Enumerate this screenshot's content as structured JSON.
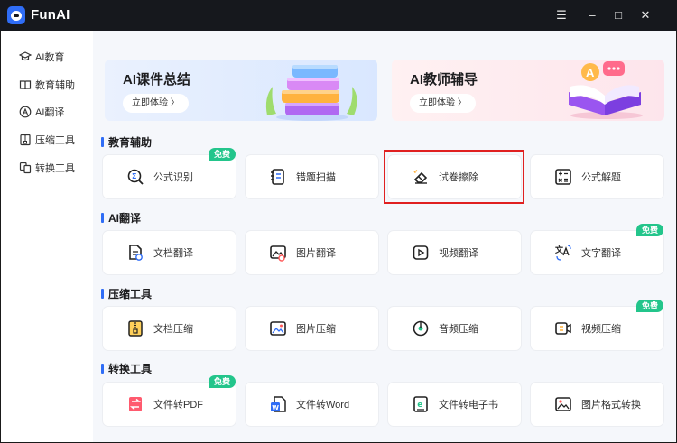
{
  "app": {
    "title": "FunAI"
  },
  "window_controls": [
    {
      "name": "menu-icon",
      "glyph": "☰"
    },
    {
      "name": "minimize-icon",
      "glyph": "–"
    },
    {
      "name": "maximize-icon",
      "glyph": "□"
    },
    {
      "name": "close-icon",
      "glyph": "✕"
    }
  ],
  "sidebar": {
    "items": [
      {
        "label": "AI教育",
        "icon": "graduation-cap-icon"
      },
      {
        "label": "教育辅助",
        "icon": "book-icon"
      },
      {
        "label": "AI翻译",
        "icon": "translate-icon"
      },
      {
        "label": "压缩工具",
        "icon": "compress-icon"
      },
      {
        "label": "转换工具",
        "icon": "convert-icon"
      }
    ]
  },
  "banners": [
    {
      "title": "AI课件总结",
      "button": "立即体验 〉"
    },
    {
      "title": "AI教师辅导",
      "button": "立即体验 〉"
    }
  ],
  "sections": [
    {
      "title": "教育辅助",
      "cards": [
        {
          "label": "公式识别",
          "icon": "formula-recognition-icon",
          "badge": "免费"
        },
        {
          "label": "错题扫描",
          "icon": "wrong-question-scan-icon",
          "badge": ""
        },
        {
          "label": "试卷擦除",
          "icon": "paper-eraser-icon",
          "badge": ""
        },
        {
          "label": "公式解题",
          "icon": "formula-solve-icon",
          "badge": ""
        }
      ]
    },
    {
      "title": "AI翻译",
      "cards": [
        {
          "label": "文档翻译",
          "icon": "document-translate-icon",
          "badge": ""
        },
        {
          "label": "图片翻译",
          "icon": "image-translate-icon",
          "badge": ""
        },
        {
          "label": "视频翻译",
          "icon": "video-translate-icon",
          "badge": ""
        },
        {
          "label": "文字翻译",
          "icon": "text-translate-icon",
          "badge": "免费"
        }
      ]
    },
    {
      "title": "压缩工具",
      "cards": [
        {
          "label": "文档压缩",
          "icon": "document-compress-icon",
          "badge": ""
        },
        {
          "label": "图片压缩",
          "icon": "image-compress-icon",
          "badge": ""
        },
        {
          "label": "音频压缩",
          "icon": "audio-compress-icon",
          "badge": ""
        },
        {
          "label": "视频压缩",
          "icon": "video-compress-icon",
          "badge": "免费"
        }
      ]
    },
    {
      "title": "转换工具",
      "cards": [
        {
          "label": "文件转PDF",
          "icon": "pdf-convert-icon",
          "badge": "免费"
        },
        {
          "label": "文件转Word",
          "icon": "word-convert-icon",
          "badge": ""
        },
        {
          "label": "文件转电子书",
          "icon": "ebook-convert-icon",
          "badge": ""
        },
        {
          "label": "图片格式转换",
          "icon": "image-format-convert-icon",
          "badge": ""
        }
      ]
    }
  ],
  "colors": {
    "titlebar": "#16181d",
    "accent": "#2f6df6",
    "badge": "#23c58b",
    "highlight": "#e02020"
  }
}
